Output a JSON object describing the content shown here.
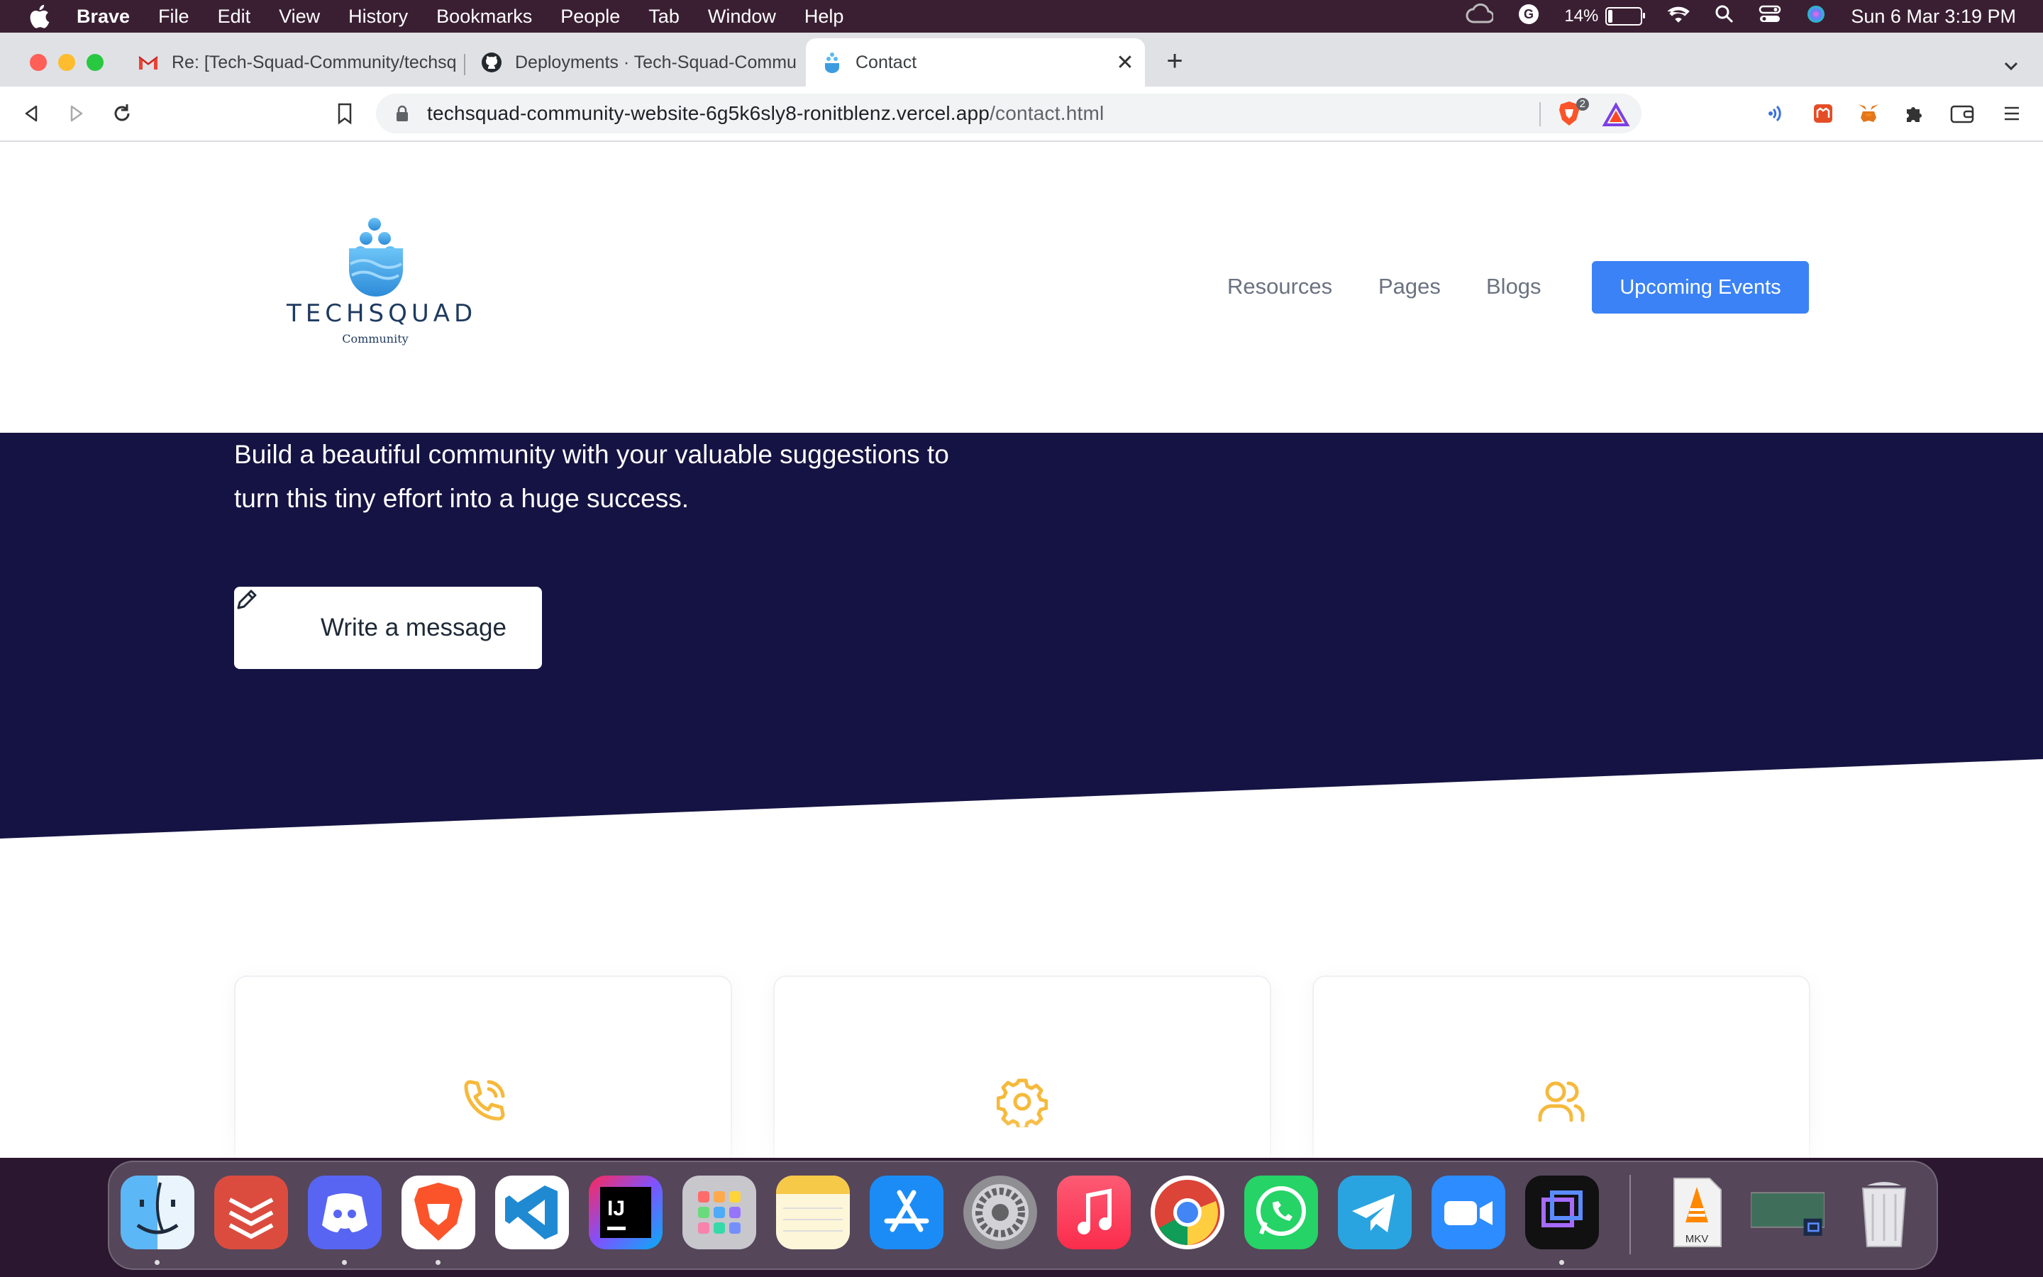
{
  "menubar": {
    "app_name": "Brave",
    "items": [
      "File",
      "Edit",
      "View",
      "History",
      "Bookmarks",
      "People",
      "Tab",
      "Window",
      "Help"
    ],
    "battery_percent": "14%",
    "battery_level": 0.14,
    "datetime": "Sun 6 Mar  3:19 PM"
  },
  "browser": {
    "tabs": [
      {
        "title": "Re: [Tech-Squad-Community/techsq",
        "icon": "gmail-icon",
        "active": false
      },
      {
        "title": "Deployments · Tech-Squad-Commu",
        "icon": "github-icon",
        "active": false
      },
      {
        "title": "Contact",
        "icon": "techsquad-favicon",
        "active": true
      }
    ],
    "url_host": "techsquad-community-website-6g5k6sly8-ronitblenz.vercel.app",
    "url_path": "/contact.html",
    "shield_count": "2"
  },
  "site": {
    "logo_text": "TECHSQUAD",
    "logo_sub": "Community",
    "nav": {
      "resources": "Resources",
      "pages": "Pages",
      "blogs": "Blogs",
      "cta": "Upcoming Events"
    },
    "hero": {
      "line1": "Build a beautiful community with your valuable suggestions to",
      "line2": "turn this tiny effort into a huge success.",
      "button": "Write a message"
    },
    "cards": [
      {
        "icon": "phone-call-icon"
      },
      {
        "icon": "gear-icon"
      },
      {
        "icon": "users-icon"
      }
    ],
    "colors": {
      "hero_bg": "#151343",
      "accent": "#3b82f6",
      "card_icon": "#f6b93b"
    }
  },
  "dock": {
    "apps": [
      "Finder",
      "Todoist",
      "Discord",
      "Brave",
      "Visual Studio Code",
      "IntelliJ IDEA",
      "Launchpad",
      "Notes",
      "App Store",
      "System Preferences",
      "Music",
      "Chrome",
      "WhatsApp",
      "Telegram",
      "Zoom",
      "Screen Recorder",
      "MKV",
      "Preview",
      "Trash"
    ],
    "mkv_label": "MKV"
  }
}
